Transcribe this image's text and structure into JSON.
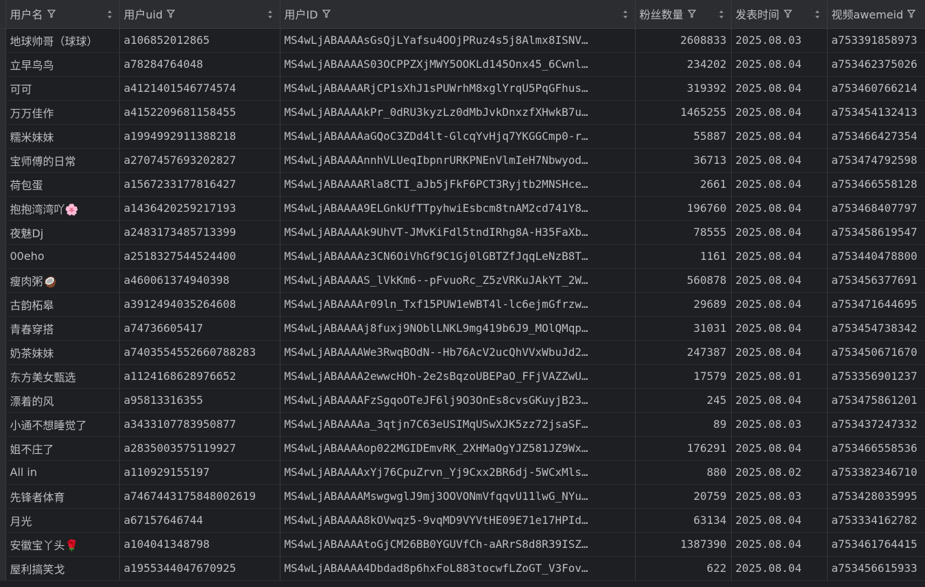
{
  "columns": [
    {
      "label": "用户名"
    },
    {
      "label": "用户uid"
    },
    {
      "label": "用户ID"
    },
    {
      "label": "粉丝数量"
    },
    {
      "label": "发表时间"
    },
    {
      "label": "视频awemeid"
    }
  ],
  "rows": [
    [
      "地球帅哥（球球）",
      "a106852012865",
      "MS4wLjABAAAAsGsQjLYafsu4OOjPRuz4s5j8Almx8ISNV…",
      "2608833",
      "2025.08.03",
      "a753391858973"
    ],
    [
      "立早鸟鸟",
      "a78284764048",
      "MS4wLjABAAAAS03OCPPZXjMWY5OOKLd145Onx45_6Cwnl…",
      "234202",
      "2025.08.04",
      "a753462375026"
    ],
    [
      "可可",
      "a4121401546774574",
      "MS4wLjABAAAARjCP1sXhJ1sPUWrhM8xglYrqU5PqGFhus…",
      "319392",
      "2025.08.04",
      "a753460766214"
    ],
    [
      "万万佳作",
      "a4152209681158455",
      "MS4wLjABAAAAkPr_0dRU3kyzLz0dMbJvkDnxzfXHwkB7u…",
      "1465255",
      "2025.08.04",
      "a753454132413"
    ],
    [
      "糯米妹妹",
      "a1994992911388218",
      "MS4wLjABAAAAaGQoC3ZDd4lt-GlcqYvHjq7YKGGCmp0-r…",
      "55887",
      "2025.08.04",
      "a753466427354"
    ],
    [
      "宝师傅的日常",
      "a2707457693202827",
      "MS4wLjABAAAAnnhVLUeqIbpnrURKPNEnVlmIeH7Nbwyod…",
      "36713",
      "2025.08.04",
      "a753474792598"
    ],
    [
      "荷包蛋",
      "a1567233177816427",
      "MS4wLjABAAAARla8CTI_aJb5jFkF6PCT3Ryjtb2MNSHce…",
      "2661",
      "2025.08.04",
      "a753466558128"
    ],
    [
      "抱抱湾湾吖🌸",
      "a1436420259217193",
      "MS4wLjABAAAA9ELGnkUfTTpyhwiEsbcm8tnAM2cd741Y8…",
      "196760",
      "2025.08.04",
      "a753468407797"
    ],
    [
      "夜魅Dj",
      "a2483173485713399",
      "MS4wLjABAAAAk9UhVT-JMvKiFdl5tndIRhg8A-H35FaXb…",
      "78555",
      "2025.08.04",
      "a753458619547"
    ],
    [
      "00eho",
      "a2518327544524400",
      "MS4wLjABAAAAz3CN6OiVhGf9C1Gj0lGBTZfJqqLeNzB8T…",
      "1161",
      "2025.08.04",
      "a753440478800"
    ],
    [
      "瘦肉粥🥥",
      "a460061374940398",
      "MS4wLjABAAAAS_lVkKm6--pFvuoRc_Z5zVRKuJAkYT_2W…",
      "560878",
      "2025.08.04",
      "a753456377691"
    ],
    [
      "古韵柘皋",
      "a3912494035264608",
      "MS4wLjABAAAAr09ln_Txf15PUW1eWBT4l-lc6ejmGfrzw…",
      "29689",
      "2025.08.04",
      "a753471644695"
    ],
    [
      "青春穿搭",
      "a74736605417",
      "MS4wLjABAAAAj8fuxj9NOblLNKL9mg419b6J9_MOlQMqp…",
      "31031",
      "2025.08.04",
      "a753454738342"
    ],
    [
      "奶茶妹妹",
      "a7403554552660788283",
      "MS4wLjABAAAAWe3RwqBOdN--Hb76AcV2ucQhVVxWbuJd2…",
      "247387",
      "2025.08.04",
      "a753450671670"
    ],
    [
      "东方美女甄选",
      "a1124168628976652",
      "MS4wLjABAAAA2ewwcHOh-2e2sBqzoUBEPaO_FFjVAZZwU…",
      "17579",
      "2025.08.01",
      "a753356901237"
    ],
    [
      "漂着的风",
      "a95813316355",
      "MS4wLjABAAAAFzSgqoOTeJF6lj9O3OnEs8cvsGKuyjB23…",
      "245",
      "2025.08.04",
      "a753475861201"
    ],
    [
      "小通不想睡觉了",
      "a3433107783950877",
      "MS4wLjABAAAAa_3qtjn7C63eUSIMqUSwXJK5zz72jsaSF…",
      "89",
      "2025.08.03",
      "a753437247332"
    ],
    [
      "姐不庄了",
      "a2835003575119927",
      "MS4wLjABAAAAop022MGIDEmvRK_2XHMaOgYJZ581JZ9Wx…",
      "176291",
      "2025.08.04",
      "a753466558536"
    ],
    [
      "All in",
      "a110929155197",
      "MS4wLjABAAAAxYj76CpuZrvn_Yj9Cxx2BR6dj-5WCxMls…",
      "880",
      "2025.08.02",
      "a753382346710"
    ],
    [
      "先锋者体育",
      "a7467443175848002619",
      "MS4wLjABAAAAMswgwglJ9mj3OOVONmVfqqvU11lwG_NYu…",
      "20759",
      "2025.08.03",
      "a753428035995"
    ],
    [
      "月光",
      "a67157646744",
      "MS4wLjABAAAA8kOVwqz5-9vqMD9VYVtHE09E71e17HPId…",
      "63134",
      "2025.08.04",
      "a753334162782"
    ],
    [
      "安徽宝丫头🌹",
      "a104041348798",
      "MS4wLjABAAAAtoGjCM26BB0YGUVfCh-aARrS8d8R39ISZ…",
      "1387390",
      "2025.08.04",
      "a753461764415"
    ],
    [
      "屋利搞笑戈",
      "a1955344047670925",
      "MS4wLjABAAAA4Dbdad8p6hxFoL883tocwfLZoGT_V3Fov…",
      "622",
      "2025.08.04",
      "a753456615933"
    ]
  ]
}
